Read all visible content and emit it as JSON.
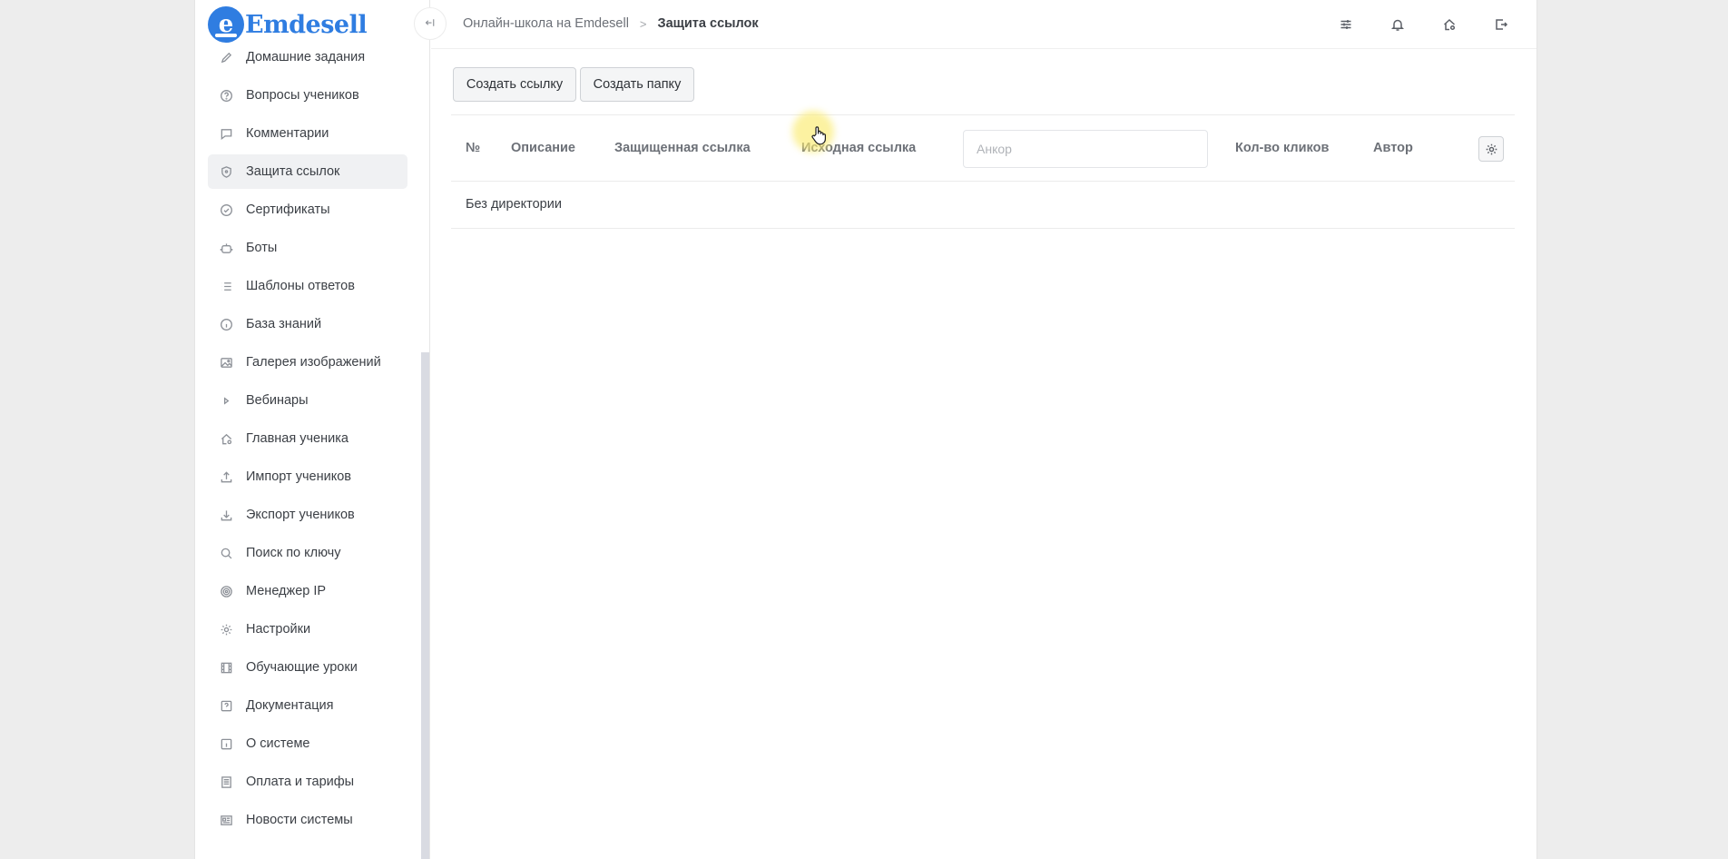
{
  "app": {
    "logo_letter": "e",
    "logo_text": "Emdesell"
  },
  "sidebar": {
    "items": [
      {
        "label": "Домашние задания",
        "icon": "pencil-icon"
      },
      {
        "label": "Вопросы учеников",
        "icon": "question-circle-icon"
      },
      {
        "label": "Комментарии",
        "icon": "comment-icon"
      },
      {
        "label": "Защита ссылок",
        "icon": "shield-icon",
        "active": true
      },
      {
        "label": "Сертификаты",
        "icon": "check-circle-icon"
      },
      {
        "label": "Боты",
        "icon": "robot-icon"
      },
      {
        "label": "Шаблоны ответов",
        "icon": "list-icon"
      },
      {
        "label": "База знаний",
        "icon": "info-circle-icon"
      },
      {
        "label": "Галерея изображений",
        "icon": "image-icon"
      },
      {
        "label": "Вебинары",
        "icon": "play-icon"
      },
      {
        "label": "Главная ученика",
        "icon": "home-gear-icon"
      },
      {
        "label": "Импорт учеников",
        "icon": "upload-icon"
      },
      {
        "label": "Экспорт учеников",
        "icon": "download-icon"
      },
      {
        "label": "Поиск по ключу",
        "icon": "search-icon"
      },
      {
        "label": "Менеджер IP",
        "icon": "target-icon"
      },
      {
        "label": "Настройки",
        "icon": "gear-icon"
      },
      {
        "label": "Обучающие уроки",
        "icon": "film-icon"
      },
      {
        "label": "Документация",
        "icon": "help-square-icon"
      },
      {
        "label": "О системе",
        "icon": "info-square-icon"
      },
      {
        "label": "Оплата и тарифы",
        "icon": "receipt-icon"
      },
      {
        "label": "Новости системы",
        "icon": "news-icon"
      }
    ]
  },
  "topbar": {
    "breadcrumb_parent": "Онлайн-школа на Emdesell",
    "breadcrumb_separator": ">",
    "breadcrumb_current": "Защита ссылок",
    "icons": [
      "sliders-icon",
      "bell-icon",
      "home-gear-icon",
      "logout-icon"
    ]
  },
  "toolbar": {
    "create_link_label": "Создать ссылку",
    "create_folder_label": "Создать папку"
  },
  "table": {
    "columns": {
      "number": "№",
      "description": "Описание",
      "protected_link": "Защищенная ссылка",
      "source_link": "Исходная ссылка",
      "clicks": "Кол-во кликов",
      "author": "Автор"
    },
    "anchor_placeholder": "Анкор",
    "anchor_value": "",
    "rows": [
      {
        "label": "Без директории"
      }
    ]
  }
}
